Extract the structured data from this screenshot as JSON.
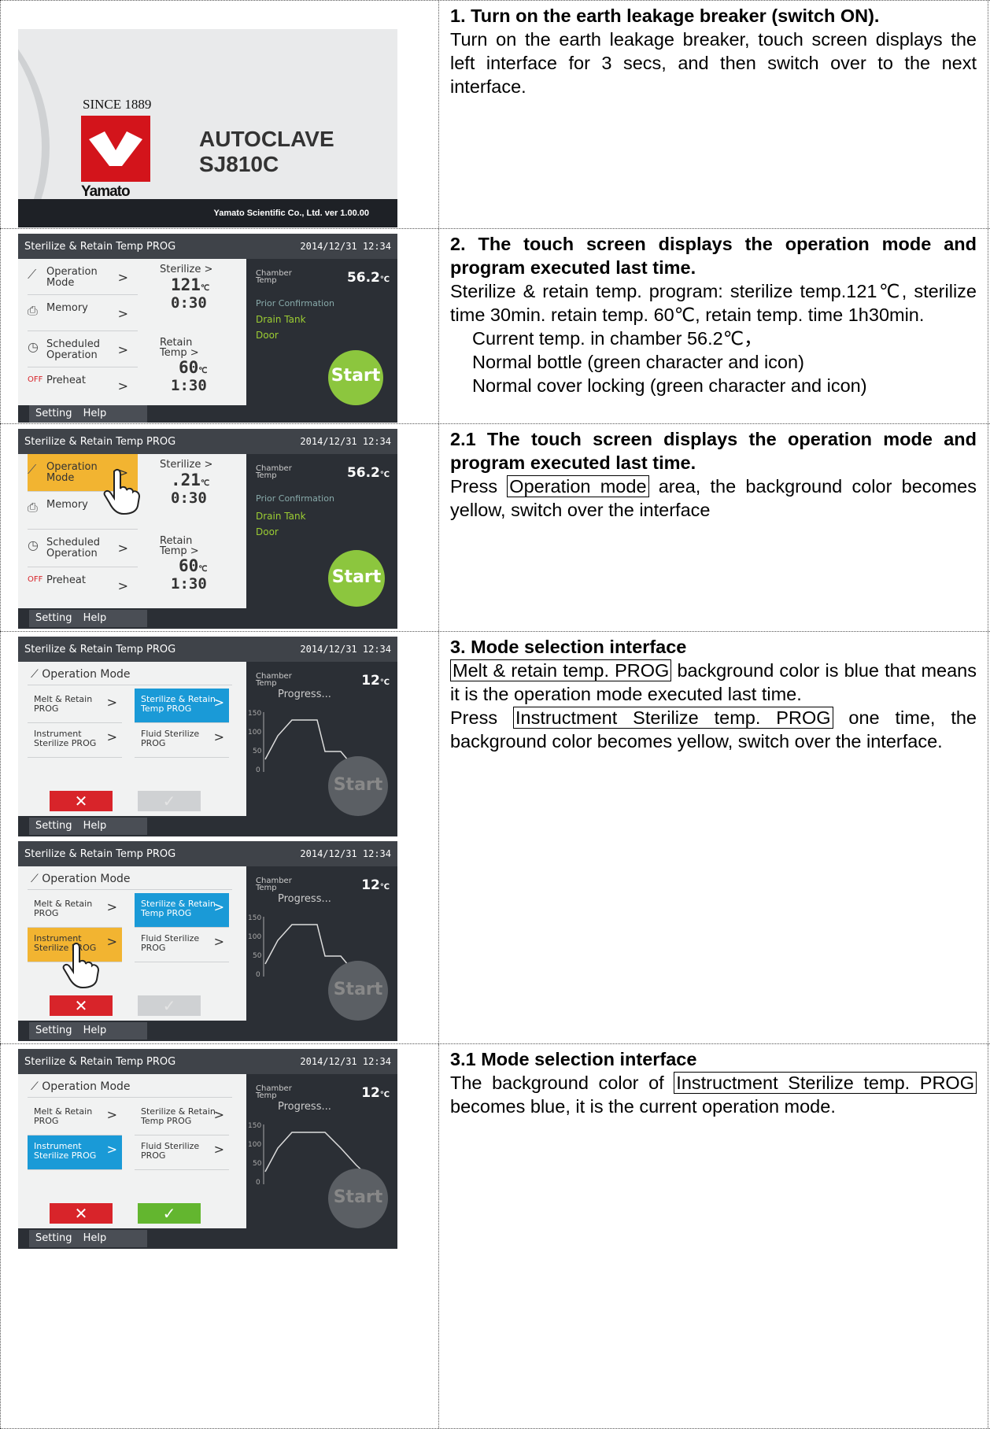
{
  "rows": [
    {
      "heading": "1. Turn on the earth leakage breaker (switch ON).",
      "body": "Turn on the earth leakage breaker, touch screen displays the left interface for 3 secs, and then switch over to the next interface."
    },
    {
      "heading": "2. The touch screen displays the operation mode and program executed last time.",
      "body": "Sterilize & retain temp. program: sterilize temp.121℃, sterilize time 30min. retain temp. 60℃, retain temp. time 1h30min.",
      "lines": [
        "Current temp. in chamber 56.2℃，",
        "Normal bottle (green character and icon)",
        "Normal cover locking (green character and icon)"
      ]
    },
    {
      "heading": "2.1 The touch screen displays the operation mode and program executed last time.",
      "body_pre": "Press ",
      "boxed": "Operation mode",
      "body_post": " area, the background color becomes yellow, switch over the interface"
    },
    {
      "heading": "3. Mode selection interface",
      "boxed1": "Melt & retain temp. PROG",
      "body1": " background color is blue that means it is the operation mode executed last time.",
      "body2_pre": "Press ",
      "boxed2": "Instructment Sterilize temp. PROG",
      "body2_post": " one time, the background color becomes yellow, switch over the interface."
    },
    {
      "heading": "3.1 Mode selection interface",
      "body_pre": "The background color of ",
      "boxed": "Instructment Sterilize temp. PROG",
      "body_post": " becomes blue, it is the current operation mode."
    }
  ],
  "splash": {
    "since": "SINCE 1889",
    "brand": "Yamato",
    "title1": "AUTOCLAVE",
    "title2": "SJ810C",
    "footer": "Yamato Scientific Co., Ltd.   ver 1.00.00"
  },
  "screen": {
    "title": "Sterilize & Retain Temp PROG",
    "datetime": "2014/12/31 12:34",
    "operation_mode": "Operation Mode",
    "memory": "Memory",
    "scheduled": "Scheduled Operation",
    "preheat": "Preheat",
    "preheat_off": "OFF",
    "sterilize": "Sterilize",
    "sterilize_temp": "121",
    "sterilize_temp_pressed": ".21",
    "sterilize_time": "0:30",
    "retain": "Retain Temp",
    "retain_temp": "60",
    "retain_time": "1:30",
    "unit": "℃",
    "chamber": "Chamber Temp",
    "chamber_value": "56.2",
    "chamber_value_mode": "12",
    "prior": "Prior Confirmation",
    "drain": "Drain Tank",
    "door": "Door",
    "start": "Start",
    "setting": "Setting",
    "help": "Help",
    "progress": "Progress...",
    "melt": "Melt & Retain PROG",
    "ster_retain": "Sterilize & Retain Temp PROG",
    "instrument": "Instrument Sterilize PROG",
    "fluid": "Fluid Sterilize PROG",
    "y_ticks": [
      "150",
      "100",
      "50",
      "0"
    ]
  }
}
